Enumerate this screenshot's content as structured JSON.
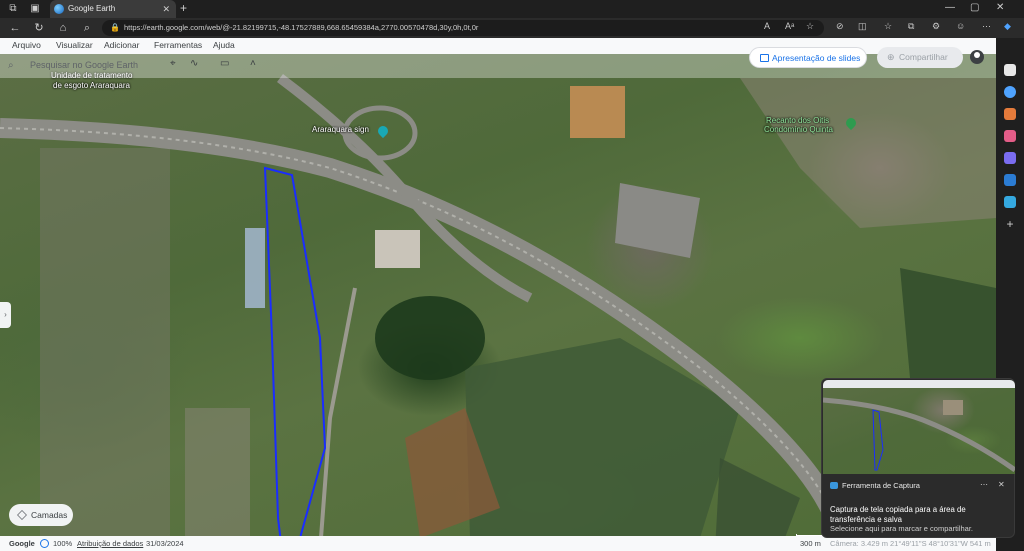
{
  "browser": {
    "tab_title": "Google Earth",
    "tab_close": "✕",
    "new_tab": "+",
    "url": "https://earth.google.com/web/@-21.82199715,-48.17527889,668.65459384a,2770.00570478d,30y,0h,0t,0r"
  },
  "menu": {
    "items": [
      "Arquivo",
      "Visualizar",
      "Adicionar",
      "Ferramentas",
      "Ajuda"
    ]
  },
  "search": {
    "placeholder": "Pesquisar no Google Earth"
  },
  "buttons": {
    "slides": "Apresentação de slides",
    "share": "Compartilhar",
    "layers": "Camadas"
  },
  "map_labels": {
    "treatment_line1": "Unidade de tratamento",
    "treatment_line2": "de esgoto Araraquara",
    "sign": "Araraquara sign",
    "condo_line1": "Recanto dos Oitis",
    "condo_line2": "Condomínio Quinta"
  },
  "status": {
    "brand": "Google",
    "zoom": "100%",
    "attribution": "Atribuição de dados",
    "date": "31/03/2024",
    "scale": "300 m",
    "camera": "Câmera: 3.429 m",
    "coords": "21°49'11\"S 48°10'31\"W 541 m"
  },
  "toast": {
    "app": "Ferramenta de Captura",
    "message": "Captura de tela copiada para a área de transferência e salva",
    "sub": "Selecione aqui para marcar e compartilhar."
  },
  "colors": {
    "polygon": "#1a2dff",
    "accent": "#1a73e8"
  }
}
